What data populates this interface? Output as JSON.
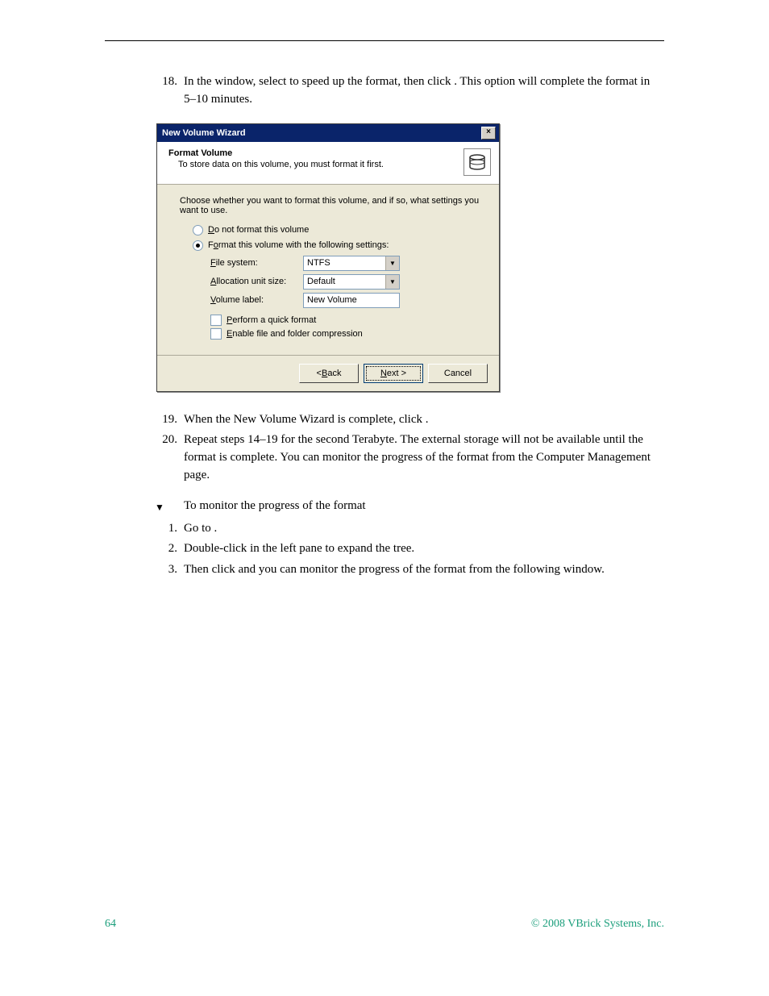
{
  "steps": {
    "s18_a": "In the ",
    "s18_b": " window, select ",
    "s18_c": " to speed up the format, then click ",
    "s18_d": ". This option will complete the format in 5–10 minutes.",
    "s19_a": "When the New Volume Wizard is complete, click ",
    "s19_b": ".",
    "s20": "Repeat steps 14–19 for the second Terabyte. The external storage will not be available until the format is complete. You can monitor the progress of the format from the Computer Management page."
  },
  "sub": {
    "heading": "To monitor the progress of the format",
    "s1_a": "Go to ",
    "s1_b": ".",
    "s2_a": "Double-click ",
    "s2_b": " in the left pane to expand the tree.",
    "s3_a": "Then click ",
    "s3_b": " and you can monitor the progress of the format from the following window."
  },
  "nums": {
    "n18": "18.",
    "n19": "19.",
    "n20": "20.",
    "m1": "1.",
    "m2": "2.",
    "m3": "3."
  },
  "dialog": {
    "title": "New Volume Wizard",
    "close": "×",
    "h_title": "Format Volume",
    "h_sub": "To store data on this volume, you must format it first.",
    "prompt": "Choose whether you want to format this volume, and if so, what settings you want to use.",
    "radio1": "o not format this volume",
    "radio1_u": "D",
    "radio2": "rmat this volume with the following settings:",
    "radio2_u": "o",
    "radio2_pre": "F",
    "fs_label": "ile system:",
    "fs_u": "F",
    "fs_value": "NTFS",
    "au_label": "llocation unit size:",
    "au_u": "A",
    "au_value": "Default",
    "vl_label": "olume label:",
    "vl_u": "V",
    "vl_value": "New Volume",
    "chk1": "erform a quick format",
    "chk1_u": "P",
    "chk2": "nable file and folder compression",
    "chk2_u": "E",
    "btn_back": "ack",
    "btn_back_pre": "< ",
    "btn_back_u": "B",
    "btn_next": "ext >",
    "btn_next_u": "N",
    "btn_cancel": "Cancel"
  },
  "footer": {
    "page": "64",
    "copyright": "© 2008 VBrick Systems, Inc."
  }
}
